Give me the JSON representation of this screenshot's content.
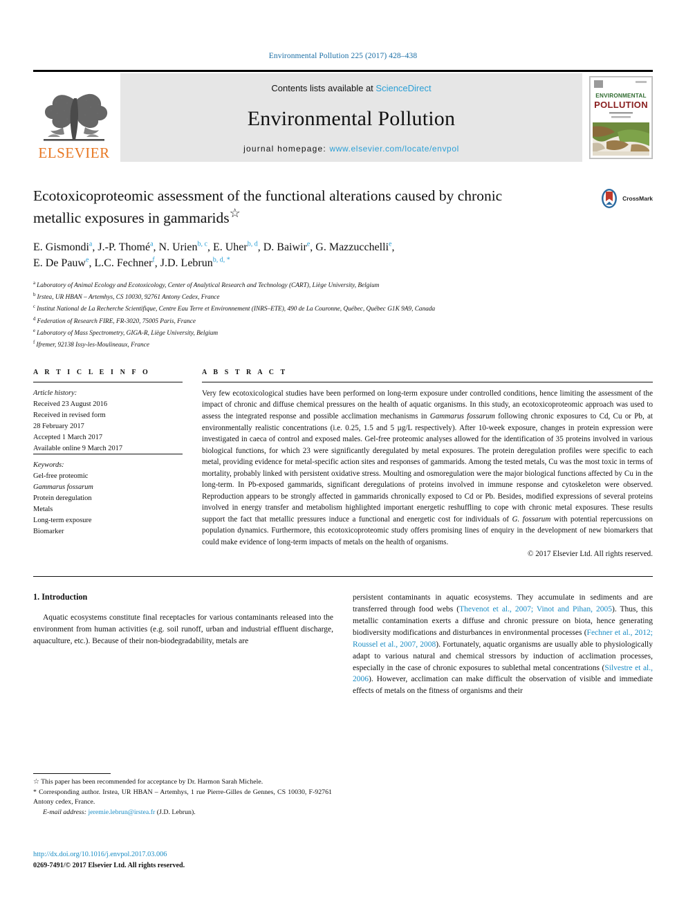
{
  "running_head": "Environmental Pollution 225 (2017) 428–438",
  "masthead": {
    "contents_prefix": "Contents lists available at ",
    "sciencedirect": "ScienceDirect",
    "journal_name": "Environmental Pollution",
    "homepage_prefix": "journal homepage: ",
    "homepage_url": "www.elsevier.com/locate/envpol",
    "publisher": "ELSEVIER",
    "cover_title_line1": "ENVIRONMENTAL",
    "cover_title_line2": "POLLUTION",
    "accent_blue": "#2a9fd6",
    "elsevier_orange": "#E87722"
  },
  "article": {
    "title": "Ecotoxicoproteomic assessment of the functional alterations caused by chronic metallic exposures in gammarids",
    "title_footnote_mark": "☆",
    "crossmark_label": "CrossMark",
    "authors_line1": "E. Gismondi ᵃ, J.-P. Thomé ᵃ, N. Urien ᵇ,ᶜ, E. Uher ᵇ,ᵈ, D. Baiwir ᵉ, G. Mazzucchelli ᵉ,",
    "authors_line2": "E. De Pauw ᵉ, L.C. Fechner ᶠ, J.D. Lebrun ᵇ,ᵈ,*",
    "authors": [
      {
        "name": "E. Gismondi",
        "sup": "a"
      },
      {
        "name": "J.-P. Thomé",
        "sup": "a"
      },
      {
        "name": "N. Urien",
        "sup": "b, c"
      },
      {
        "name": "E. Uher",
        "sup": "b, d"
      },
      {
        "name": "D. Baiwir",
        "sup": "e"
      },
      {
        "name": "G. Mazzucchelli",
        "sup": "e"
      },
      {
        "name": "E. De Pauw",
        "sup": "e"
      },
      {
        "name": "L.C. Fechner",
        "sup": "f"
      },
      {
        "name": "J.D. Lebrun",
        "sup": "b, d, *"
      }
    ],
    "affiliations": [
      {
        "mark": "a",
        "text": "Laboratory of Animal Ecology and Ecotoxicology, Center of Analytical Research and Technology (CART), Liège University, Belgium"
      },
      {
        "mark": "b",
        "text": "Irstea, UR HBAN – Artemhys, CS 10030, 92761 Antony Cedex, France"
      },
      {
        "mark": "c",
        "text": "Institut National de La Recherche Scientifique, Centre Eau Terre et Environnement (INRS–ETE), 490 de La Couronne, Québec, Québec G1K 9A9, Canada"
      },
      {
        "mark": "d",
        "text": "Federation of Research FIRE, FR-3020, 75005 Paris, France"
      },
      {
        "mark": "e",
        "text": "Laboratory of Mass Spectrometry, GIGA-R, Liège University, Belgium"
      },
      {
        "mark": "f",
        "text": "Ifremer, 92138 Issy-les-Moulineaux, France"
      }
    ]
  },
  "article_info": {
    "heading": "A R T I C L E   I N F O",
    "history_label": "Article history:",
    "history": [
      "Received 23 August 2016",
      "Received in revised form",
      "28 February 2017",
      "Accepted 1 March 2017",
      "Available online 9 March 2017"
    ],
    "keywords_label": "Keywords:",
    "keywords": [
      "Gel-free proteomic",
      "Gammarus fossarum",
      "Protein deregulation",
      "Metals",
      "Long-term exposure",
      "Biomarker"
    ],
    "keyword_italic_index": 1
  },
  "abstract": {
    "heading": "A B S T R A C T",
    "paragraph_1": "Very few ecotoxicological studies have been performed on long-term exposure under controlled conditions, hence limiting the assessment of the impact of chronic and diffuse chemical pressures on the health of aquatic organisms. In this study, an ecotoxicoproteomic approach was used to assess the integrated response and possible acclimation mechanisms in ",
    "species_1": "Gammarus fossarum",
    "paragraph_2": " following chronic exposures to Cd, Cu or Pb, at environmentally realistic concentrations (i.e. 0.25, 1.5 and 5 µg/L respectively). After 10-week exposure, changes in protein expression were investigated in caeca of control and exposed males. Gel-free proteomic analyses allowed for the identification of 35 proteins involved in various biological functions, for which 23 were significantly deregulated by metal exposures. The protein deregulation profiles were specific to each metal, providing evidence for metal-specific action sites and responses of gammarids. Among the tested metals, Cu was the most toxic in terms of mortality, probably linked with persistent oxidative stress. Moulting and osmoregulation were the major biological functions affected by Cu in the long-term. In Pb-exposed gammarids, significant deregulations of proteins involved in immune response and cytoskeleton were observed. Reproduction appears to be strongly affected in gammarids chronically exposed to Cd or Pb. Besides, modified expressions of several proteins involved in energy transfer and metabolism highlighted important energetic reshuffling to cope with chronic metal exposures. These results support the fact that metallic pressures induce a functional and energetic cost for individuals of ",
    "species_2": "G. fossarum",
    "paragraph_3": " with potential repercussions on population dynamics. Furthermore, this ecotoxicoproteomic study offers promising lines of enquiry in the development of new biomarkers that could make evidence of long-term impacts of metals on the health of organisms.",
    "copyright": "© 2017 Elsevier Ltd. All rights reserved."
  },
  "body": {
    "section_heading": "1. Introduction",
    "left_paragraph": "Aquatic ecosystems constitute final receptacles for various contaminants released into the environment from human activities (e.g. soil runoff, urban and industrial effluent discharge, aquaculture, etc.). Because of their non-biodegradability, metals are",
    "right_paragraph_parts": [
      {
        "text": "persistent contaminants in aquatic ecosystems. They accumulate in sediments and are transferred through food webs (",
        "ref": false
      },
      {
        "text": "Thevenot et al., 2007; Vinot and Pihan, 2005",
        "ref": true
      },
      {
        "text": "). Thus, this metallic contamination exerts a diffuse and chronic pressure on biota, hence generating biodiversity modifications and disturbances in environmental processes (",
        "ref": false
      },
      {
        "text": "Fechner et al., 2012; Roussel et al., 2007, 2008",
        "ref": true
      },
      {
        "text": "). Fortunately, aquatic organisms are usually able to physiologically adapt to various natural and chemical stressors by induction of acclimation processes, especially in the case of chronic exposures to sublethal metal concentrations (",
        "ref": false
      },
      {
        "text": "Silvestre et al., 2006",
        "ref": true
      },
      {
        "text": "). However, acclimation can make difficult the observation of visible and immediate effects of metals on the fitness of organisms and their",
        "ref": false
      }
    ]
  },
  "footnotes": {
    "star_mark": "☆",
    "star_text": " This paper has been recommended for acceptance by Dr. Harmon Sarah Michele.",
    "corr_mark": "*",
    "corr_text": " Corresponding author. Irstea, UR HBAN – Artemhys, 1 rue Pierre-Gilles de Gennes, CS 10030, F-92761 Antony cedex, France.",
    "email_label": "E-mail address:",
    "email": "jeremie.lebrun@irstea.fr",
    "email_owner": "(J.D. Lebrun).",
    "doi": "http://dx.doi.org/10.1016/j.envpol.2017.03.006",
    "issn_line": "0269-7491/© 2017 Elsevier Ltd. All rights reserved."
  }
}
